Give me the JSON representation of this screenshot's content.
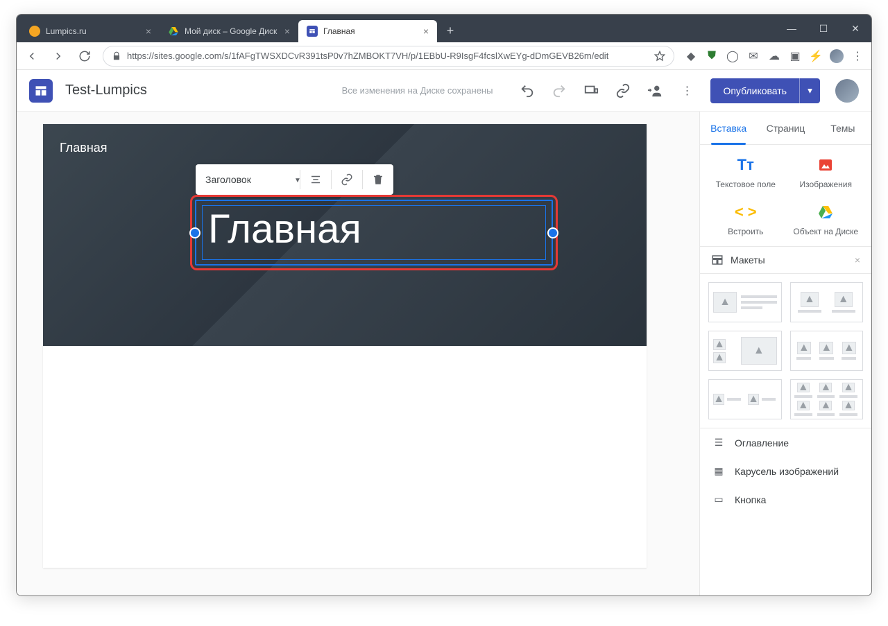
{
  "browser": {
    "tabs": [
      {
        "title": "Lumpics.ru",
        "active": false,
        "favicon": "#f5a623"
      },
      {
        "title": "Мой диск – Google Диск",
        "active": false,
        "favicon": "drive"
      },
      {
        "title": "Главная",
        "active": true,
        "favicon": "sites"
      }
    ],
    "url": "https://sites.google.com/s/1fAFgTWSXDCvR391tsP0v7hZMBOKT7VH/p/1EBbU-R9IsgF4fcslXwEYg-dDmGEVB26m/edit"
  },
  "app": {
    "site_title": "Test-Lumpics",
    "save_status": "Все изменения на Диске сохранены",
    "publish_label": "Опубликовать"
  },
  "hero": {
    "page_label": "Главная",
    "title_text": "Главная",
    "toolbar": {
      "style_select": "Заголовок"
    }
  },
  "sidebar": {
    "tabs": [
      "Вставка",
      "Страниц",
      "Темы"
    ],
    "active_tab": 0,
    "insert_items": [
      "Текстовое поле",
      "Изображения",
      "Встроить",
      "Объект на Диске"
    ],
    "layouts_label": "Макеты",
    "bottom_items": [
      "Оглавление",
      "Карусель изображений",
      "Кнопка"
    ]
  }
}
